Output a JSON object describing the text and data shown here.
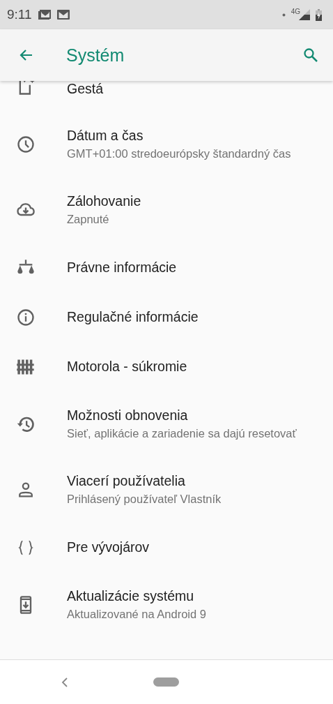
{
  "status_bar": {
    "time": "9:11",
    "network": "4G"
  },
  "app_bar": {
    "title": "Systém"
  },
  "items": [
    {
      "kind": "gesture",
      "title": "Gestá",
      "partial": true
    },
    {
      "kind": "clock",
      "title": "Dátum a čas",
      "subtitle": "GMT+01:00 stredoeurópsky štandardný čas"
    },
    {
      "kind": "cloud",
      "title": "Zálohovanie",
      "subtitle": "Zapnuté"
    },
    {
      "kind": "scale",
      "title": "Právne informácie"
    },
    {
      "kind": "info",
      "title": "Regulačné informácie"
    },
    {
      "kind": "fence",
      "title": "Motorola - súkromie"
    },
    {
      "kind": "restore",
      "title": "Možnosti obnovenia",
      "subtitle": "Sieť, aplikácie a zariadenie sa dajú resetovať"
    },
    {
      "kind": "person",
      "title": "Viacerí používatelia",
      "subtitle": "Prihlásený používateľ Vlastník"
    },
    {
      "kind": "braces",
      "title": "Pre vývojárov"
    },
    {
      "kind": "update",
      "title": "Aktualizácie systému",
      "subtitle": "Aktualizované na Android 9"
    }
  ]
}
